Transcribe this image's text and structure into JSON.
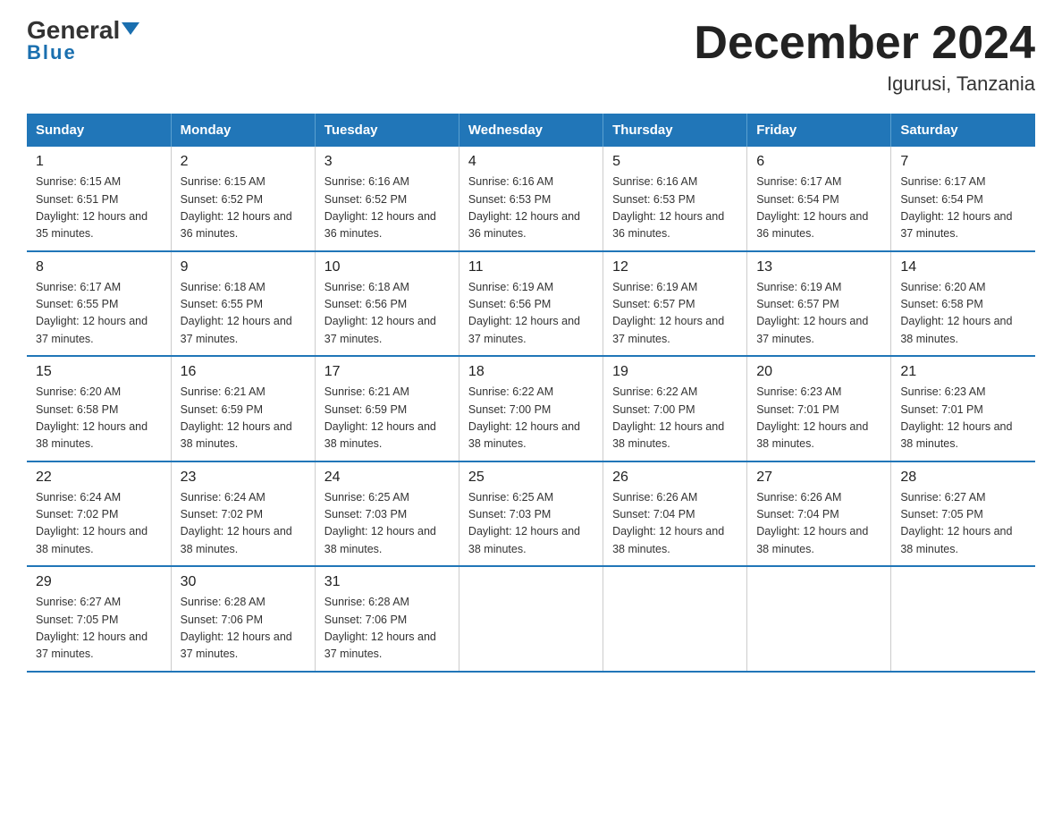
{
  "logo": {
    "general": "General",
    "blue": "Blue"
  },
  "title": "December 2024",
  "subtitle": "Igurusi, Tanzania",
  "days_of_week": [
    "Sunday",
    "Monday",
    "Tuesday",
    "Wednesday",
    "Thursday",
    "Friday",
    "Saturday"
  ],
  "weeks": [
    [
      {
        "day": "1",
        "sunrise": "6:15 AM",
        "sunset": "6:51 PM",
        "daylight": "12 hours and 35 minutes."
      },
      {
        "day": "2",
        "sunrise": "6:15 AM",
        "sunset": "6:52 PM",
        "daylight": "12 hours and 36 minutes."
      },
      {
        "day": "3",
        "sunrise": "6:16 AM",
        "sunset": "6:52 PM",
        "daylight": "12 hours and 36 minutes."
      },
      {
        "day": "4",
        "sunrise": "6:16 AM",
        "sunset": "6:53 PM",
        "daylight": "12 hours and 36 minutes."
      },
      {
        "day": "5",
        "sunrise": "6:16 AM",
        "sunset": "6:53 PM",
        "daylight": "12 hours and 36 minutes."
      },
      {
        "day": "6",
        "sunrise": "6:17 AM",
        "sunset": "6:54 PM",
        "daylight": "12 hours and 36 minutes."
      },
      {
        "day": "7",
        "sunrise": "6:17 AM",
        "sunset": "6:54 PM",
        "daylight": "12 hours and 37 minutes."
      }
    ],
    [
      {
        "day": "8",
        "sunrise": "6:17 AM",
        "sunset": "6:55 PM",
        "daylight": "12 hours and 37 minutes."
      },
      {
        "day": "9",
        "sunrise": "6:18 AM",
        "sunset": "6:55 PM",
        "daylight": "12 hours and 37 minutes."
      },
      {
        "day": "10",
        "sunrise": "6:18 AM",
        "sunset": "6:56 PM",
        "daylight": "12 hours and 37 minutes."
      },
      {
        "day": "11",
        "sunrise": "6:19 AM",
        "sunset": "6:56 PM",
        "daylight": "12 hours and 37 minutes."
      },
      {
        "day": "12",
        "sunrise": "6:19 AM",
        "sunset": "6:57 PM",
        "daylight": "12 hours and 37 minutes."
      },
      {
        "day": "13",
        "sunrise": "6:19 AM",
        "sunset": "6:57 PM",
        "daylight": "12 hours and 37 minutes."
      },
      {
        "day": "14",
        "sunrise": "6:20 AM",
        "sunset": "6:58 PM",
        "daylight": "12 hours and 38 minutes."
      }
    ],
    [
      {
        "day": "15",
        "sunrise": "6:20 AM",
        "sunset": "6:58 PM",
        "daylight": "12 hours and 38 minutes."
      },
      {
        "day": "16",
        "sunrise": "6:21 AM",
        "sunset": "6:59 PM",
        "daylight": "12 hours and 38 minutes."
      },
      {
        "day": "17",
        "sunrise": "6:21 AM",
        "sunset": "6:59 PM",
        "daylight": "12 hours and 38 minutes."
      },
      {
        "day": "18",
        "sunrise": "6:22 AM",
        "sunset": "7:00 PM",
        "daylight": "12 hours and 38 minutes."
      },
      {
        "day": "19",
        "sunrise": "6:22 AM",
        "sunset": "7:00 PM",
        "daylight": "12 hours and 38 minutes."
      },
      {
        "day": "20",
        "sunrise": "6:23 AM",
        "sunset": "7:01 PM",
        "daylight": "12 hours and 38 minutes."
      },
      {
        "day": "21",
        "sunrise": "6:23 AM",
        "sunset": "7:01 PM",
        "daylight": "12 hours and 38 minutes."
      }
    ],
    [
      {
        "day": "22",
        "sunrise": "6:24 AM",
        "sunset": "7:02 PM",
        "daylight": "12 hours and 38 minutes."
      },
      {
        "day": "23",
        "sunrise": "6:24 AM",
        "sunset": "7:02 PM",
        "daylight": "12 hours and 38 minutes."
      },
      {
        "day": "24",
        "sunrise": "6:25 AM",
        "sunset": "7:03 PM",
        "daylight": "12 hours and 38 minutes."
      },
      {
        "day": "25",
        "sunrise": "6:25 AM",
        "sunset": "7:03 PM",
        "daylight": "12 hours and 38 minutes."
      },
      {
        "day": "26",
        "sunrise": "6:26 AM",
        "sunset": "7:04 PM",
        "daylight": "12 hours and 38 minutes."
      },
      {
        "day": "27",
        "sunrise": "6:26 AM",
        "sunset": "7:04 PM",
        "daylight": "12 hours and 38 minutes."
      },
      {
        "day": "28",
        "sunrise": "6:27 AM",
        "sunset": "7:05 PM",
        "daylight": "12 hours and 38 minutes."
      }
    ],
    [
      {
        "day": "29",
        "sunrise": "6:27 AM",
        "sunset": "7:05 PM",
        "daylight": "12 hours and 37 minutes."
      },
      {
        "day": "30",
        "sunrise": "6:28 AM",
        "sunset": "7:06 PM",
        "daylight": "12 hours and 37 minutes."
      },
      {
        "day": "31",
        "sunrise": "6:28 AM",
        "sunset": "7:06 PM",
        "daylight": "12 hours and 37 minutes."
      },
      null,
      null,
      null,
      null
    ]
  ]
}
